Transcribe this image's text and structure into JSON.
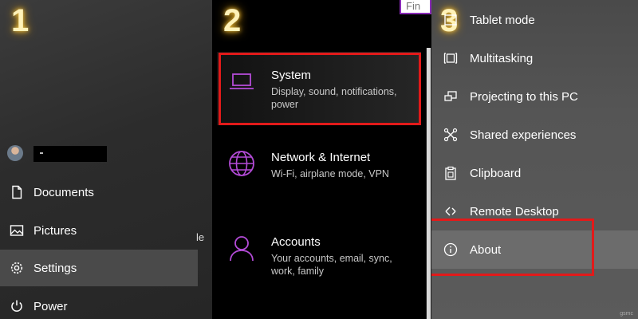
{
  "panel1": {
    "step": "1",
    "menu": [
      {
        "label": "Documents",
        "icon": "document-icon"
      },
      {
        "label": "Pictures",
        "icon": "pictures-icon"
      },
      {
        "label": "Settings",
        "icon": "gear-icon",
        "active": true
      },
      {
        "label": "Power",
        "icon": "power-icon"
      }
    ],
    "stray_text": "le"
  },
  "panel2": {
    "step": "2",
    "search_placeholder": "Fin",
    "categories": [
      {
        "title": "System",
        "description": "Display, sound, notifications, power",
        "icon": "laptop-icon",
        "highlighted": true
      },
      {
        "title": "Network & Internet",
        "description": "Wi-Fi, airplane mode, VPN",
        "icon": "globe-icon"
      },
      {
        "title": "Accounts",
        "description": "Your accounts, email, sync, work, family",
        "icon": "person-icon"
      }
    ],
    "accent_color": "#b44bd8"
  },
  "panel3": {
    "step": "3",
    "items": [
      {
        "label": "Tablet mode",
        "icon": "tablet-icon"
      },
      {
        "label": "Multitasking",
        "icon": "multitasking-icon"
      },
      {
        "label": "Projecting to this PC",
        "icon": "projecting-icon"
      },
      {
        "label": "Shared experiences",
        "icon": "shared-experiences-icon"
      },
      {
        "label": "Clipboard",
        "icon": "clipboard-icon"
      },
      {
        "label": "Remote Desktop",
        "icon": "remote-desktop-icon"
      },
      {
        "label": "About",
        "icon": "info-icon",
        "active": true,
        "highlighted": true
      }
    ],
    "watermark": "gsmc"
  },
  "colors": {
    "highlight_box": "#e21a1a",
    "step_number": "#f5c542"
  }
}
